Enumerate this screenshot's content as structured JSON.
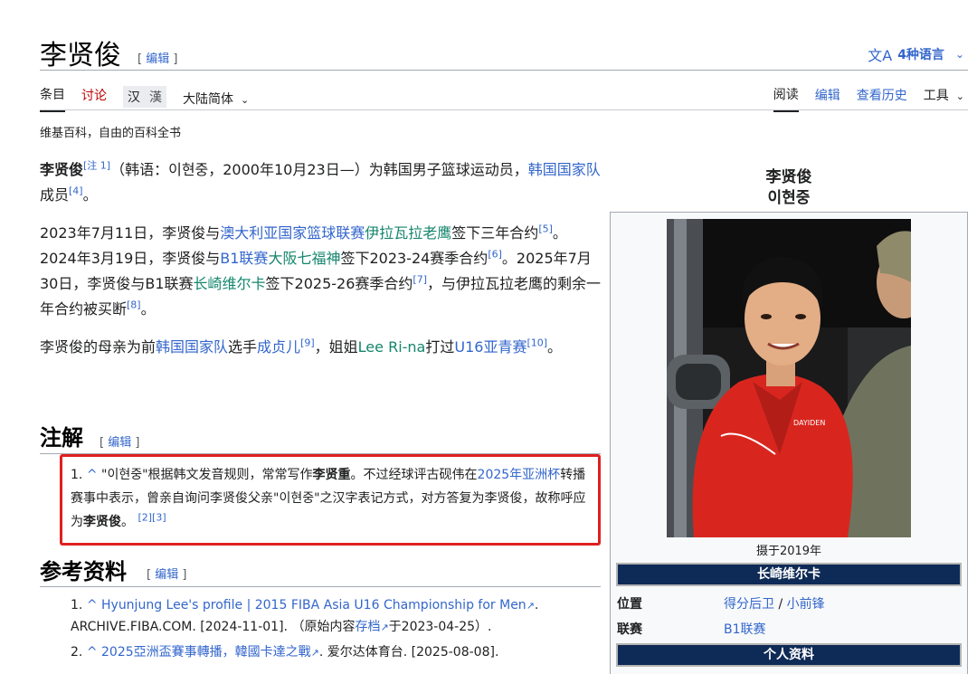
{
  "page": {
    "title": "李贤俊",
    "edit_label": "编辑",
    "languages_label": "4种语言",
    "tagline": "维基百科，自由的百科全书"
  },
  "tabs": {
    "article": "条目",
    "talk": "讨论",
    "variant_han": "汉",
    "variant_trad": "漢",
    "lang_variant": "大陆简体",
    "read": "阅读",
    "edit": "编辑",
    "history": "查看历史",
    "tools": "工具"
  },
  "intro": {
    "name_bold": "李贤俊",
    "note_ref": "[注 1]",
    "text_1": "（韩语：이현중，2000年10月23日—）为韩国男子篮球运动员，",
    "link_team": "韩国国家队",
    "text_2": "成员",
    "ref_4": "[4]",
    "text_3": "。"
  },
  "para2": {
    "t1": "2023年7月11日，李贤俊与",
    "l1": "澳大利亚国家篮球联赛",
    "l2": "伊拉瓦拉老鹰",
    "t2": "签下三年合约",
    "r5": "[5]",
    "t3": "。2024年3月19日，李贤俊与",
    "l3": "B1联赛",
    "l4": "大阪七福神",
    "t4": "签下2023-24赛季合约",
    "r6": "[6]",
    "t5": "。2025年7月30日，李贤俊与B1联赛",
    "l5": "长崎维尔卡",
    "t6": "签下2025-26赛季合约",
    "r7": "[7]",
    "t7": "，与伊拉瓦拉老鹰的剩余一年合约被买断",
    "r8": "[8]",
    "t8": "。"
  },
  "para3": {
    "t1": "李贤俊的母亲为前",
    "l1": "韩国国家队",
    "t2": "选手",
    "l2": "成贞儿",
    "r9": "[9]",
    "t3": "，姐姐",
    "l3": "Lee Ri-na",
    "t4": "打过",
    "l4": "U16亚青赛",
    "r10": "[10]",
    "t5": "。"
  },
  "notes": {
    "heading": "注解",
    "number": "1.",
    "caret": "^",
    "t1": "\"이현중\"根据韩文发音规则，常常写作",
    "b1": "李贤重",
    "t2": "。不过经球评古砚伟在",
    "l1": "2025年亚洲杯",
    "t3": "转播赛事中表示，曾亲自询问李贤俊父亲\"이현중\"之汉字表记方式，对方答复为李贤俊，故称呼应为",
    "b2": "李贤俊",
    "t4": "。",
    "refs": "[2][3]"
  },
  "references": {
    "heading": "参考资料",
    "items": [
      {
        "number": "1.",
        "caret": "^",
        "title": "Hyunjung Lee's profile | 2015 FIBA Asia U16 Championship for Men",
        "after_title": ".",
        "publisher": "ARCHIVE.FIBA.COM. [2024-11-01]. （原始内容",
        "archive_link": "存档",
        "archive_date": "于2023-04-25）."
      },
      {
        "number": "2.",
        "caret": "^",
        "title": "2025亞洲盃賽事轉播，韓國卡達之戰",
        "after_title": ". 爱尔达体育台. [2025-08-08]."
      }
    ]
  },
  "infobox": {
    "name_zh": "李贤俊",
    "name_ko": "이현중",
    "caption": "摄于2019年",
    "team_header": "长崎维尔卡",
    "position_label": "位置",
    "position_1": "得分后卫",
    "position_sep": " / ",
    "position_2": "小前锋",
    "league_label": "联赛",
    "league_value": "B1联赛",
    "personal_header": "个人资料",
    "photo_shirt_text": "DAYIDEN"
  },
  "colors": {
    "link": "#3366cc",
    "link_green": "#14866d",
    "talk_red": "#ba0000",
    "infobox_header": "#0e2a56",
    "highlight_box": "#e02020"
  }
}
